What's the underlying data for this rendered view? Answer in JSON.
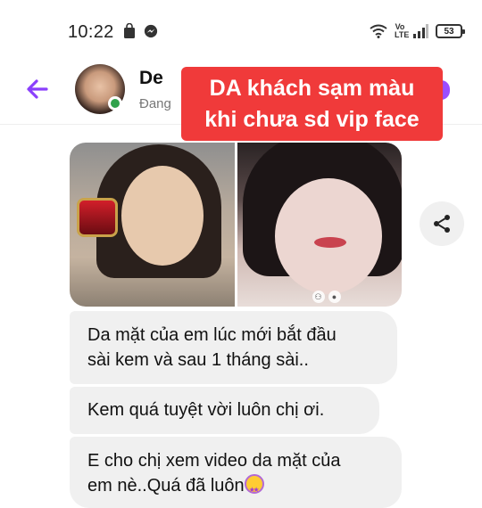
{
  "status_bar": {
    "time": "10:22",
    "network_label": "Vo LTE",
    "battery": "53",
    "icons": [
      "bag-icon",
      "messenger-icon",
      "wifi-icon",
      "signal-icon",
      "battery-icon"
    ]
  },
  "header": {
    "contact_name": "De",
    "contact_status": "Đang",
    "icons": [
      "back-arrow-icon",
      "avatar"
    ],
    "accent_color": "#9b4dff",
    "online_color": "#31a24c"
  },
  "caption": {
    "line1": "DA khách sạm màu",
    "line2": "khi chưa sd vip face",
    "background": "#f03a3a"
  },
  "photos": {
    "left_label": "photo-before",
    "right_label": "photo-after"
  },
  "share": {
    "icon": "share-icon"
  },
  "messages": [
    {
      "line1": "Da mặt của em lúc mới bắt đầu",
      "line2": "sài kem và sau 1 tháng sài.."
    },
    {
      "line1": "Kem quá tuyệt vời luôn chị ơi."
    },
    {
      "line1": "E cho chị xem video da mặt của",
      "line2": "em nè..Quá đã luôn"
    }
  ]
}
